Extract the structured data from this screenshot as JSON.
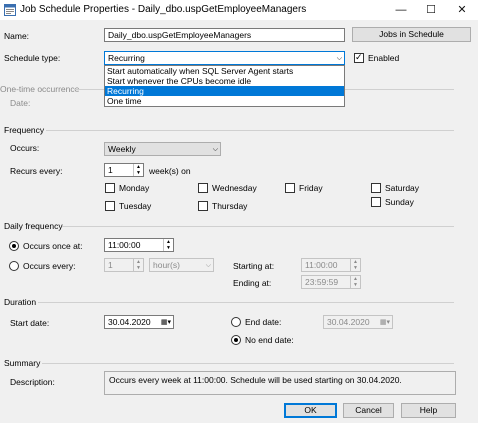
{
  "window": {
    "title": "Job Schedule Properties - Daily_dbo.uspGetEmployeeManagers",
    "minimize": "—",
    "maximize": "☐",
    "close": "✕"
  },
  "form": {
    "name_label": "Name:",
    "name_value": "Daily_dbo.uspGetEmployeeManagers",
    "jobs_button": "Jobs in Schedule",
    "schedule_type_label": "Schedule type:",
    "schedule_type_value": "Recurring",
    "enabled_label": "Enabled",
    "enabled": true,
    "schedule_type_options": [
      "Start automatically when SQL Server Agent starts",
      "Start whenever the CPUs become idle",
      "Recurring",
      "One time"
    ],
    "schedule_type_selected_index": 2
  },
  "one_time": {
    "title": "One-time occurrence",
    "date_label": "Date:"
  },
  "frequency": {
    "title": "Frequency",
    "occurs_label": "Occurs:",
    "occurs_value": "Weekly",
    "recurs_label": "Recurs every:",
    "recurs_value": "1",
    "recurs_unit": "week(s) on",
    "days": {
      "monday": "Monday",
      "tuesday": "Tuesday",
      "wednesday": "Wednesday",
      "thursday": "Thursday",
      "friday": "Friday",
      "saturday": "Saturday",
      "sunday": "Sunday"
    }
  },
  "daily": {
    "title": "Daily frequency",
    "once_label": "Occurs once at:",
    "once_value": "11:00:00",
    "every_label": "Occurs every:",
    "every_value": "1",
    "every_unit": "hour(s)",
    "starting_label": "Starting at:",
    "starting_value": "11:00:00",
    "ending_label": "Ending at:",
    "ending_value": "23:59:59"
  },
  "duration": {
    "title": "Duration",
    "start_label": "Start date:",
    "start_value": "30.04.2020",
    "end_label": "End date:",
    "end_value": "30.04.2020",
    "no_end_label": "No end date:"
  },
  "summary": {
    "title": "Summary",
    "description_label": "Description:",
    "description_value": "Occurs every week at 11:00:00. Schedule will be used starting on 30.04.2020."
  },
  "buttons": {
    "ok": "OK",
    "cancel": "Cancel",
    "help": "Help"
  },
  "colors": {
    "selection": "#0078d7",
    "background": "#f0f0f0"
  }
}
